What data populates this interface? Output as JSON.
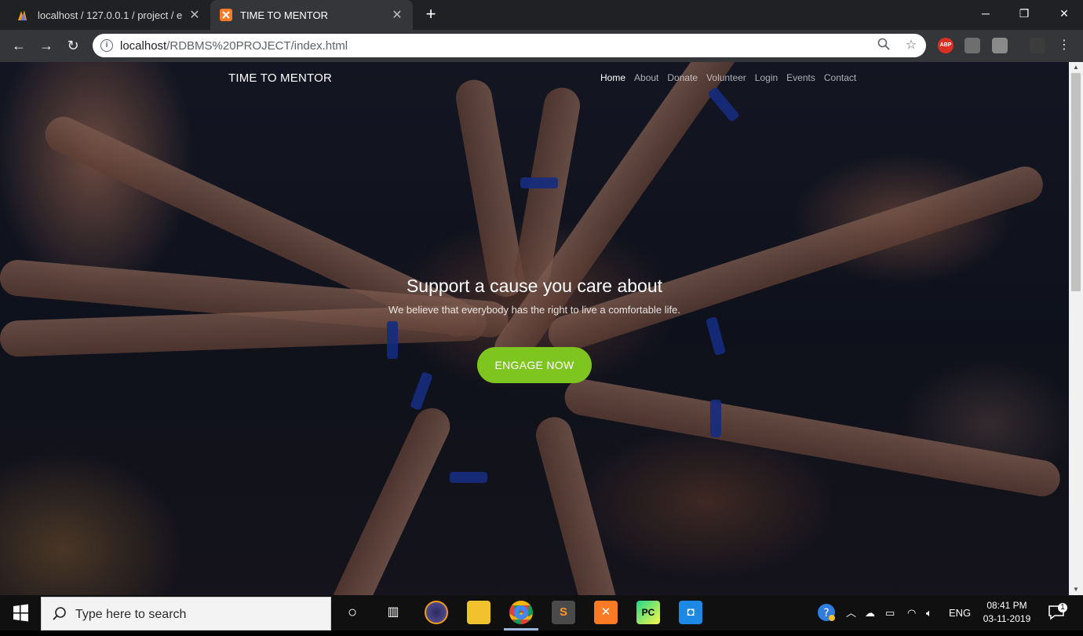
{
  "browser": {
    "tabs": [
      {
        "title": "localhost / 127.0.0.1 / project / e",
        "active": false
      },
      {
        "title": "TIME TO MENTOR",
        "active": true
      }
    ],
    "new_tab": "+",
    "url_host": "localhost",
    "url_path": "/RDBMS%20PROJECT/index.html",
    "extensions": [
      "ABP"
    ]
  },
  "page": {
    "brand": "TIME TO MENTOR",
    "nav": [
      "Home",
      "About",
      "Donate",
      "Volunteer",
      "Login",
      "Events",
      "Contact"
    ],
    "active_nav": "Home",
    "hero_title": "Support a cause you care about",
    "hero_subtitle": "We believe that everybody has the right to live a comfortable life.",
    "cta": "ENGAGE NOW",
    "colors": {
      "cta": "#7fc51f"
    }
  },
  "taskbar": {
    "search_placeholder": "Type here to search",
    "language": "ENG",
    "time": "08:41 PM",
    "date": "03-11-2019",
    "notification_count": "1"
  }
}
